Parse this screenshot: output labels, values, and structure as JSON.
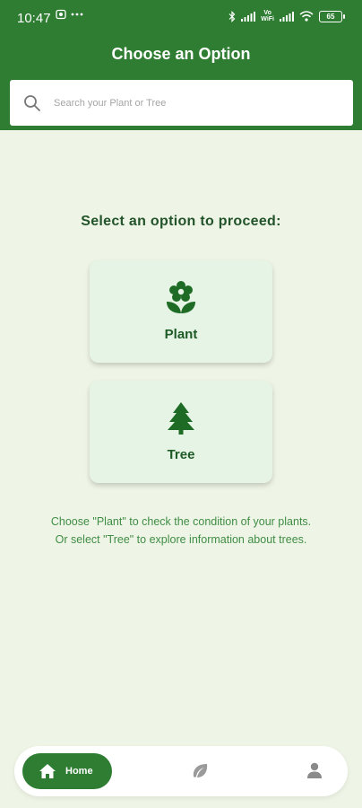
{
  "status_bar": {
    "time": "10:47",
    "battery": "65",
    "network_label_top": "Vo",
    "network_label_bottom": "WiFi",
    "icons": [
      "screen-record-icon",
      "more-dots-icon",
      "bluetooth-icon",
      "signal-icon",
      "wifi-icon",
      "battery-icon"
    ]
  },
  "header": {
    "title": "Choose an Option",
    "background_color": "#2e7d32"
  },
  "search": {
    "placeholder": "Search your Plant or Tree",
    "value": ""
  },
  "prompt": "Select an option to proceed:",
  "options": [
    {
      "label": "Plant",
      "icon": "flower-icon"
    },
    {
      "label": "Tree",
      "icon": "tree-icon"
    }
  ],
  "help_text": {
    "line1": "Choose \"Plant\" to check the condition of your plants.",
    "line2": "Or select \"Tree\" to explore information about trees."
  },
  "bottom_nav": {
    "home_label": "Home",
    "items": [
      "home-icon",
      "leaf-icon",
      "profile-icon"
    ],
    "active": "Home"
  },
  "colors": {
    "primary": "#2e7d32",
    "background": "#eff5e6",
    "card": "#e6f4e5",
    "text_dark": "#22532a",
    "text_green": "#3f8d46"
  }
}
